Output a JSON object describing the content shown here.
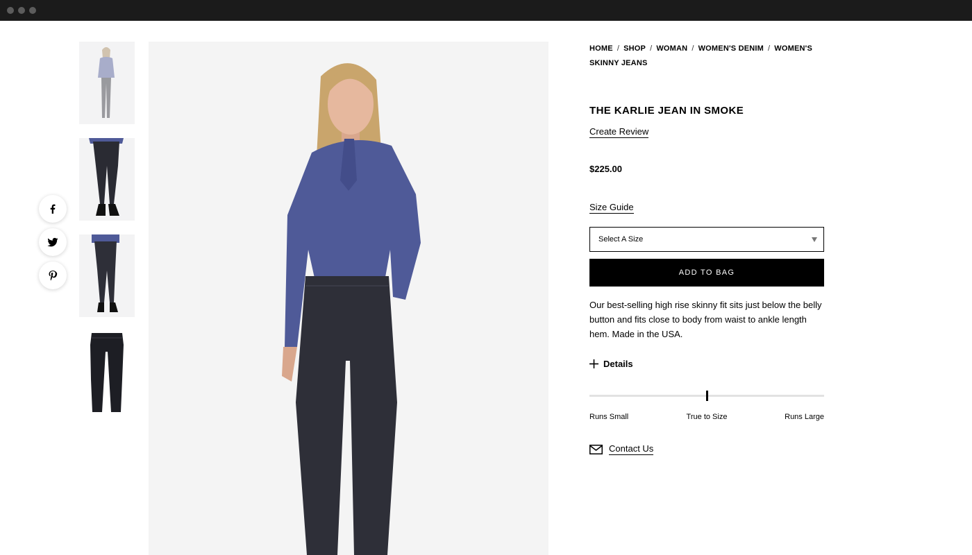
{
  "breadcrumb": [
    {
      "label": "HOME"
    },
    {
      "label": "SHOP"
    },
    {
      "label": "WOMAN"
    },
    {
      "label": "WOMEN'S DENIM"
    },
    {
      "label": "WOMEN'S SKINNY JEANS"
    }
  ],
  "breadcrumb_separator": "/",
  "product": {
    "title": "THE KARLIE JEAN IN SMOKE",
    "review_link": "Create Review",
    "price": "$225.00",
    "size_guide_link": "Size Guide",
    "size_select": {
      "selected": "Select A Size"
    },
    "add_to_bag": "ADD TO BAG",
    "description": "Our best-selling high rise skinny fit sits just below the belly button and fits close to body from waist to ankle length hem. Made in the USA.",
    "details_label": "Details",
    "fit_scale": {
      "labels": [
        "Runs Small",
        "True to Size",
        "Runs Large"
      ],
      "value_fraction": 0.5
    },
    "contact_link": "Contact Us"
  },
  "social": [
    {
      "icon": "facebook-icon"
    },
    {
      "icon": "twitter-icon"
    },
    {
      "icon": "pinterest-icon"
    }
  ],
  "colors": {
    "titlebar": "#1b1b1b",
    "shirt": "#4f5a98",
    "denim": "#2e2f38",
    "button": "#000000"
  }
}
